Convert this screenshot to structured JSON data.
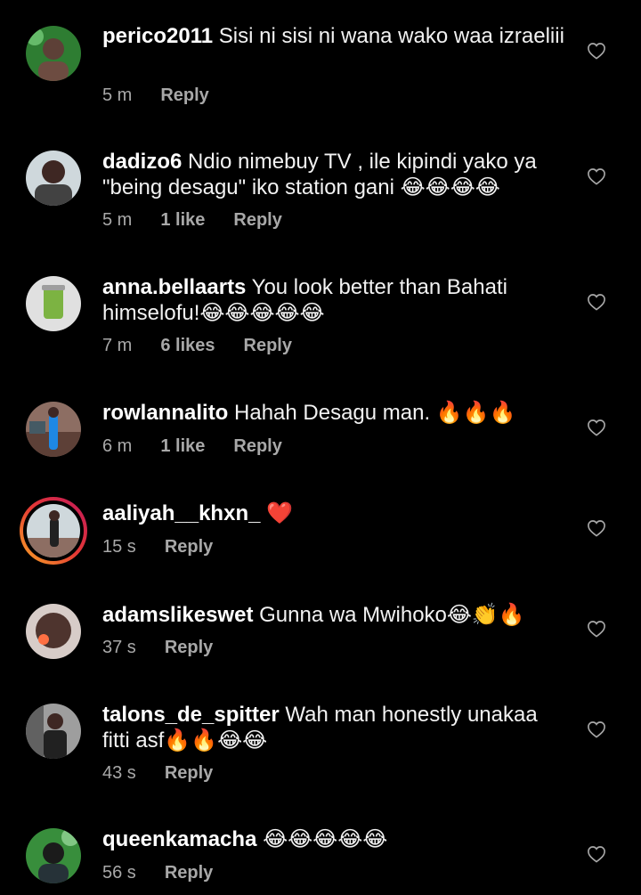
{
  "comments": [
    {
      "username": "perico2011",
      "text": "Sisi ni sisi ni wana wako waa izraeliii",
      "time": "5 m",
      "likes": "",
      "reply": "Reply"
    },
    {
      "username": "dadizo6",
      "text": "Ndio nimebuy TV , ile kipindi yako ya \"being desagu\" iko station gani 😂😂😂😂",
      "time": "5 m",
      "likes": "1 like",
      "reply": "Reply"
    },
    {
      "username": "anna.bellaarts",
      "text": "You look better than Bahati himselofu!😂😂😂😂😂",
      "time": "7 m",
      "likes": "6 likes",
      "reply": "Reply"
    },
    {
      "username": "rowlannalito",
      "text": "Hahah Desagu man. 🔥🔥🔥",
      "time": "6 m",
      "likes": "1 like",
      "reply": "Reply"
    },
    {
      "username": "aaliyah__khxn_",
      "text": "❤️",
      "time": "15 s",
      "likes": "",
      "reply": "Reply"
    },
    {
      "username": "adamslikeswet",
      "text": "Gunna wa Mwihoko😂👏🔥",
      "time": "37 s",
      "likes": "",
      "reply": "Reply"
    },
    {
      "username": "talons_de_spitter",
      "text": "Wah man honestly unakaa fitti asf🔥🔥😂😂",
      "time": "43 s",
      "likes": "",
      "reply": "Reply"
    },
    {
      "username": "queenkamacha",
      "text": "😂😂😂😂😂",
      "time": "56 s",
      "likes": "",
      "reply": "Reply"
    }
  ],
  "icons": {
    "like": "heart-outline-icon"
  },
  "colors": {
    "background": "#000000",
    "text": "#ffffff",
    "meta": "#a8a8a8",
    "story_ring_start": "#f9a825",
    "story_ring_end": "#c2185b"
  }
}
